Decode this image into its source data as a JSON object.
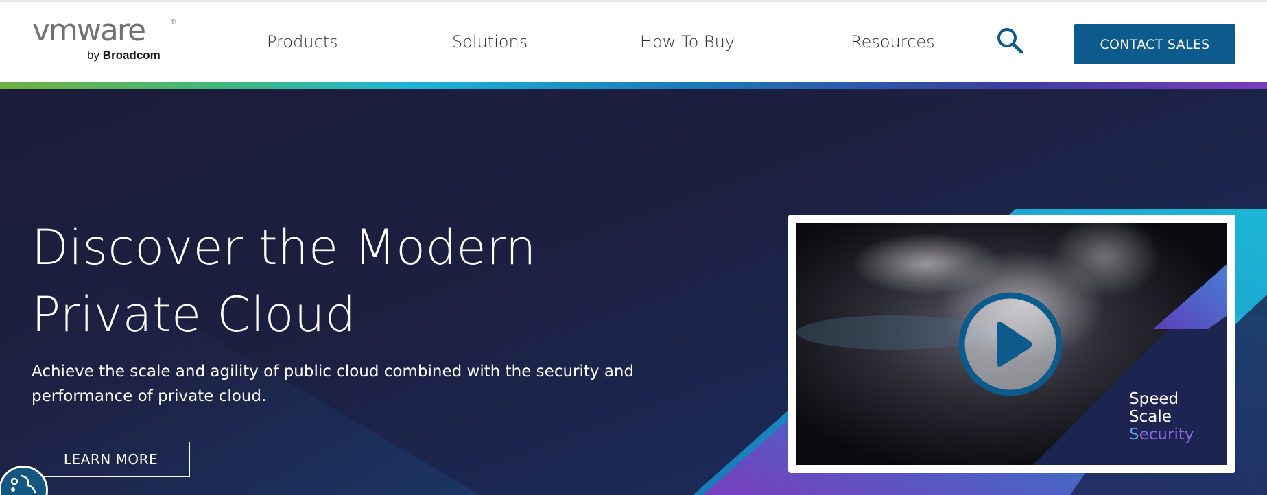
{
  "header": {
    "logo": {
      "wordmark": "vmware",
      "registered": "®",
      "by": "by",
      "company": "Broadcom"
    },
    "nav": [
      {
        "label": "Products"
      },
      {
        "label": "Solutions"
      },
      {
        "label": "How To Buy"
      },
      {
        "label": "Resources"
      }
    ],
    "search_icon": "search-icon",
    "contact_label": "CONTACT SALES"
  },
  "hero": {
    "title_line1": "Discover the Modern",
    "title_line2": "Private Cloud",
    "subtitle_line1": "Achieve the scale and agility of public cloud combined with the security and",
    "subtitle_line2": "performance of private cloud.",
    "cta_label": "LEARN MORE"
  },
  "video": {
    "play_icon": "play-icon",
    "caption": [
      "Speed",
      "Scale",
      "Security"
    ]
  },
  "accessibility_icon": "accessibility-icon",
  "colors": {
    "brand_blue": "#0d5b8c",
    "hero_bg": "#1c1d3a",
    "accent_cyan": "#1db6d6"
  }
}
